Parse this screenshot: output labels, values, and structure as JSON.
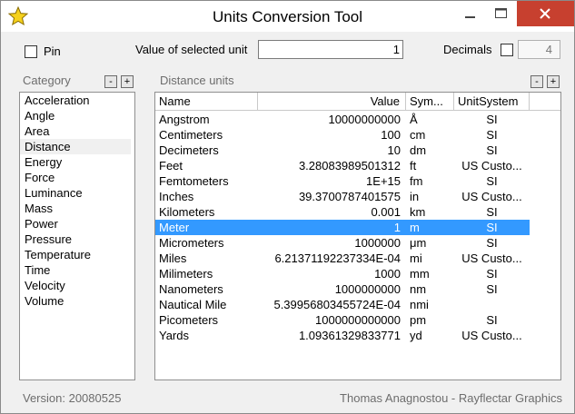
{
  "window": {
    "title": "Units Conversion Tool",
    "controls": {
      "minimize": "minimize",
      "maximize": "maximize",
      "close": "close"
    }
  },
  "top": {
    "pin_label": "Pin",
    "pin_checked": false,
    "value_label": "Value of selected unit",
    "value": "1",
    "decimals_label": "Decimals",
    "decimals_checked": false,
    "decimals_value": "4"
  },
  "category": {
    "label": "Category",
    "minus": "-",
    "plus": "+",
    "selected": "Distance",
    "items": [
      "Acceleration",
      "Angle",
      "Area",
      "Distance",
      "Energy",
      "Force",
      "Luminance",
      "Mass",
      "Power",
      "Pressure",
      "Temperature",
      "Time",
      "Velocity",
      "Volume"
    ]
  },
  "units": {
    "label": "Distance units",
    "minus": "-",
    "plus": "+",
    "columns": [
      "Name",
      "Value",
      "Sym...",
      "UnitSystem"
    ],
    "selected": "Meter",
    "rows": [
      {
        "name": "Angstrom",
        "value": "10000000000",
        "symbol": "Å",
        "system": "SI"
      },
      {
        "name": "Centimeters",
        "value": "100",
        "symbol": "cm",
        "system": "SI"
      },
      {
        "name": "Decimeters",
        "value": "10",
        "symbol": "dm",
        "system": "SI"
      },
      {
        "name": "Feet",
        "value": "3.28083989501312",
        "symbol": "ft",
        "system": "US Custo..."
      },
      {
        "name": "Femtometers",
        "value": "1E+15",
        "symbol": "fm",
        "system": "SI"
      },
      {
        "name": "Inches",
        "value": "39.3700787401575",
        "symbol": "in",
        "system": "US Custo..."
      },
      {
        "name": "Kilometers",
        "value": "0.001",
        "symbol": "km",
        "system": "SI"
      },
      {
        "name": "Meter",
        "value": "1",
        "symbol": "m",
        "system": "SI"
      },
      {
        "name": "Micrometers",
        "value": "1000000",
        "symbol": "μm",
        "system": "SI"
      },
      {
        "name": "Miles",
        "value": "6.21371192237334E-04",
        "symbol": "mi",
        "system": "US Custo..."
      },
      {
        "name": "Milimeters",
        "value": "1000",
        "symbol": "mm",
        "system": "SI"
      },
      {
        "name": "Nanometers",
        "value": "1000000000",
        "symbol": "nm",
        "system": "SI"
      },
      {
        "name": "Nautical Mile",
        "value": "5.39956803455724E-04",
        "symbol": "nmi",
        "system": ""
      },
      {
        "name": "Picometers",
        "value": "1000000000000",
        "symbol": "pm",
        "system": "SI"
      },
      {
        "name": "Yards",
        "value": "1.09361329833771",
        "symbol": "yd",
        "system": "US Custo..."
      }
    ]
  },
  "status": {
    "version": "Version: 20080525",
    "author": "Thomas Anagnostou - Rayflectar Graphics"
  },
  "colors": {
    "selection": "#3399ff",
    "close_button": "#c7402f",
    "star_icon": "#f5d11c"
  }
}
